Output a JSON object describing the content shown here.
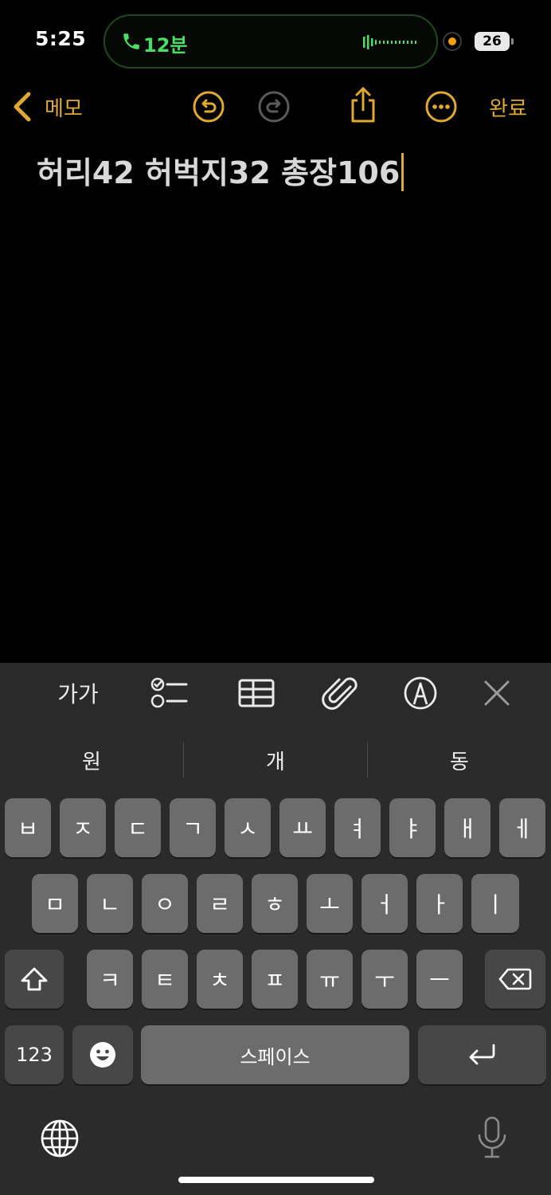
{
  "status": {
    "time": "5:25",
    "call_duration": "12분",
    "battery": "26"
  },
  "nav": {
    "back_label": "메모",
    "done_label": "완료"
  },
  "note": {
    "text": "허리42 허벅지32 총장106"
  },
  "format_toolbar": {
    "text_style_label": "가가"
  },
  "keyboard": {
    "suggestions": [
      "원",
      "개",
      "동"
    ],
    "row1": [
      "ㅂ",
      "ㅈ",
      "ㄷ",
      "ㄱ",
      "ㅅ",
      "ㅛ",
      "ㅕ",
      "ㅑ",
      "ㅐ",
      "ㅔ"
    ],
    "row2": [
      "ㅁ",
      "ㄴ",
      "ㅇ",
      "ㄹ",
      "ㅎ",
      "ㅗ",
      "ㅓ",
      "ㅏ",
      "ㅣ"
    ],
    "row3": [
      "ㅋ",
      "ㅌ",
      "ㅊ",
      "ㅍ",
      "ㅠ",
      "ㅜ",
      "ㅡ"
    ],
    "numbers_label": "123",
    "space_label": "스페이스"
  },
  "colors": {
    "accent": "#e0a931",
    "call_green": "#4ade62"
  }
}
